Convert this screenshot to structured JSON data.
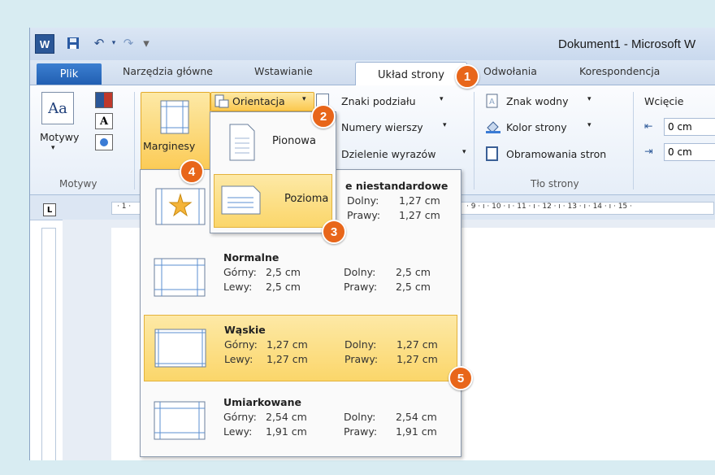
{
  "titlebar": {
    "app_letter": "W",
    "title": "Dokument1 - Microsoft W"
  },
  "tabs": {
    "file": "Plik",
    "items": [
      "Narzędzia główne",
      "Wstawianie",
      "Układ strony",
      "Odwołania",
      "Korespondencja"
    ]
  },
  "ribbon": {
    "themes_label": "Motywy",
    "themes_group": "Motywy",
    "margins_label": "Marginesy",
    "orientation_label": "Orientacja",
    "breaks": "Znaki podziału",
    "line_numbers": "Numery wierszy",
    "hyphenation": "Dzielenie wyrazów",
    "watermark": "Znak wodny",
    "page_color": "Kolor strony",
    "page_borders": "Obramowania stron",
    "page_bg_group": "Tło strony",
    "indent_label": "Wcięcie",
    "indent_left": "0 cm",
    "indent_right": "0 cm",
    "arrow": "▾",
    "theme_font_glyph": "Aa",
    "font_glyph": "A"
  },
  "ruler": {
    "corner": "L",
    "text": "· 1 ·",
    "right_text": "· 9 · ı · 10 · ı · 11 · ı · 12 · ı · 13 · ı · 14 · ı · 15 ·"
  },
  "orientation_menu": {
    "items": [
      {
        "label": "Pionowa"
      },
      {
        "label": "Pozioma"
      }
    ]
  },
  "margins_menu": {
    "custom": {
      "name": "e niestandardowe",
      "bottom_label": "Dolny:",
      "bottom": "1,27 cm",
      "right_label": "Prawy:",
      "right": "1,27 cm"
    },
    "items": [
      {
        "name": "Normalne",
        "top_label": "Górny:",
        "top": "2,5 cm",
        "bottom_label": "Dolny:",
        "bottom": "2,5 cm",
        "left_label": "Lewy:",
        "left": "2,5 cm",
        "right_label": "Prawy:",
        "right": "2,5 cm"
      },
      {
        "name": "Wąskie",
        "top_label": "Górny:",
        "top": "1,27 cm",
        "bottom_label": "Dolny:",
        "bottom": "1,27 cm",
        "left_label": "Lewy:",
        "left": "1,27 cm",
        "right_label": "Prawy:",
        "right": "1,27 cm"
      },
      {
        "name": "Umiarkowane",
        "top_label": "Górny:",
        "top": "2,54 cm",
        "bottom_label": "Dolny:",
        "bottom": "2,54 cm",
        "left_label": "Lewy:",
        "left": "1,91 cm",
        "right_label": "Prawy:",
        "right": "1,91 cm"
      }
    ]
  },
  "badges": [
    "1",
    "2",
    "3",
    "4",
    "5"
  ],
  "colors": {
    "accent": "#e8661a",
    "highlight": "#fbd66a",
    "file_tab": "#215fb2"
  }
}
